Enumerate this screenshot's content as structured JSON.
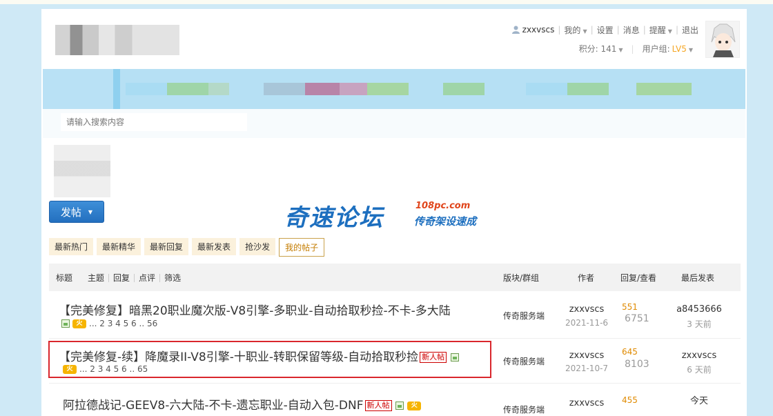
{
  "header": {
    "username": "zxxvscs",
    "menu": [
      "我的",
      "设置",
      "消息",
      "提醒",
      "退出"
    ],
    "points_label": "积分: 141",
    "group_label": "用户组:",
    "group_value": "LV5",
    "search_placeholder": "请输入搜索内容"
  },
  "post_button": "发帖",
  "brand": {
    "main": "奇速论坛",
    "domain": "108pc.com",
    "slogan": "传奇架设速成"
  },
  "tabs": [
    "最新热门",
    "最新精华",
    "最新回复",
    "最新发表",
    "抢沙发",
    "我的帖子"
  ],
  "table_header": {
    "filters": [
      "标题",
      "主题",
      "回复",
      "点评",
      "筛选"
    ],
    "forum": "版块/群组",
    "author": "作者",
    "reply_view": "回复/查看",
    "last_post": "最后发表"
  },
  "rows": [
    {
      "title": "【完美修复】暗黑20职业魔次版-V8引擎-多职业-自动拾取秒捡-不卡-多大陆",
      "pages": "... 2 3 4 5 6 .. 56",
      "forum": "传奇服务端",
      "author": "zxxvscs",
      "date": "2021-11-6",
      "replies": "551",
      "views": "6751",
      "last_user": "a8453666",
      "last_time": "3 天前"
    },
    {
      "title": "【完美修复-续】降魔录II-V8引擎-十职业-转职保留等级-自动拾取秒捡",
      "badge": "新人帖",
      "pages": "... 2 3 4 5 6 .. 65",
      "forum": "传奇服务端",
      "author": "zxxvscs",
      "date": "2021-10-7",
      "replies": "645",
      "views": "8103",
      "last_user": "zxxvscs",
      "last_time": "6 天前"
    },
    {
      "title": "阿拉德战记-GEEV8-六大陆-不卡-遗忘职业-自动入包-DNF",
      "badge": "新人帖",
      "forum": "传奇服务端",
      "author": "zxxvscs",
      "replies": "455",
      "last_time": "今天"
    }
  ],
  "icons": {
    "hot": "火"
  },
  "colors": {
    "accent_blue": "#236fbf",
    "highlight_red": "#d9262c",
    "reply_orange": "#e08a00"
  }
}
